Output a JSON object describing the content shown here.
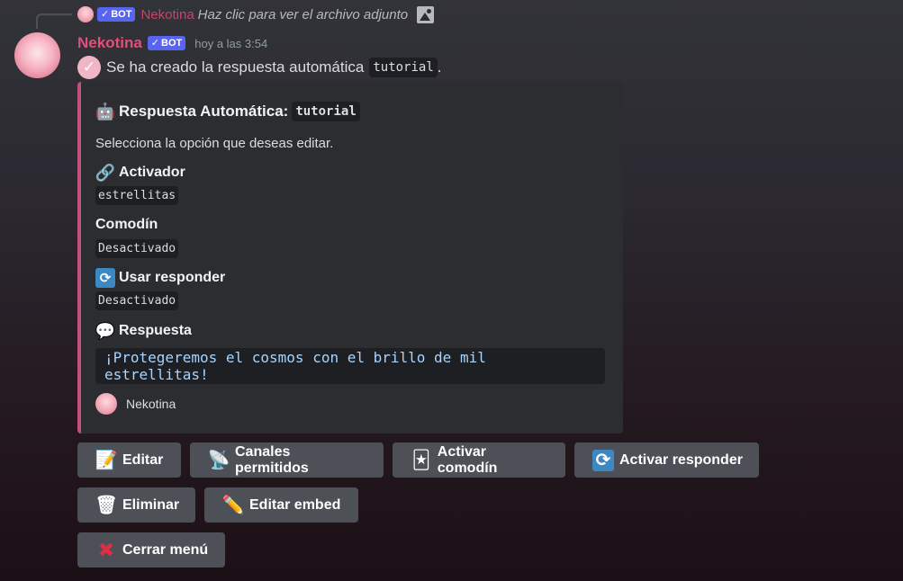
{
  "reply": {
    "bot_tag": "BOT",
    "author": "Nekotina",
    "text": "Haz clic para ver el archivo adjunto"
  },
  "message": {
    "author": "Nekotina",
    "bot_tag": "BOT",
    "timestamp": "hoy a las 3:54",
    "text_before": "Se ha creado la respuesta automática",
    "code": "tutorial",
    "text_after": "."
  },
  "embed": {
    "accent_color": "#c2527d",
    "title": "Respuesta Automática:",
    "title_code": "tutorial",
    "description": "Selecciona la opción que deseas editar.",
    "fields": [
      {
        "name": "Activador",
        "value": "estrellitas",
        "icon": "link-icon"
      },
      {
        "name": "Comodín",
        "value": "Desactivado",
        "icon": ""
      },
      {
        "name": "Usar responder",
        "value": "Desactivado",
        "icon": "repeat-icon"
      },
      {
        "name": "Respuesta",
        "value": "¡Protegeremos el cosmos con el brillo de mil estrellitas!",
        "icon": "speech-bubble-icon"
      }
    ],
    "footer": "Nekotina"
  },
  "buttons": [
    {
      "label": "Editar",
      "icon": "memo-icon"
    },
    {
      "label": "Canales permitidos",
      "icon": "satellite-antenna-icon"
    },
    {
      "label": "Activar comodín",
      "icon": "joker-card-icon"
    },
    {
      "label": "Activar responder",
      "icon": "repeat-icon"
    },
    {
      "label": "Eliminar",
      "icon": "wastebasket-icon"
    },
    {
      "label": "Editar embed",
      "icon": "pencil-icon"
    },
    {
      "label": "Cerrar menú",
      "icon": "cross-mark-icon"
    }
  ],
  "colors": {
    "author": "#e0507c",
    "bot_tag": "#5865f2",
    "button_bg": "#4e5058",
    "embed_bg": "#2b2d31"
  }
}
